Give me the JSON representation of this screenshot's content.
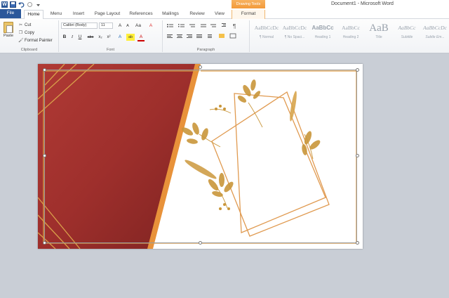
{
  "titlebar": {
    "document_title": "Document1 - Microsoft Word",
    "context_group": "Drawing Tools",
    "qat_icons": [
      "word-logo-icon",
      "save-icon",
      "undo-icon",
      "redo-icon",
      "customize-qat-icon"
    ]
  },
  "tabs": [
    {
      "label": "File"
    },
    {
      "label": "Home"
    },
    {
      "label": "Menu"
    },
    {
      "label": "Insert"
    },
    {
      "label": "Page Layout"
    },
    {
      "label": "References"
    },
    {
      "label": "Mailings"
    },
    {
      "label": "Review"
    },
    {
      "label": "View"
    },
    {
      "label": "Format"
    }
  ],
  "ribbon": {
    "clipboard": {
      "paste": "Paste",
      "cut": "Cut",
      "copy": "Copy",
      "format_painter": "Format Painter",
      "label": "Clipboard"
    },
    "font": {
      "font_name": "Calibri (Body)",
      "font_size": "11",
      "label": "Font",
      "buttons": [
        "B",
        "I",
        "U",
        "abc",
        "x₂",
        "x²",
        "A",
        "ab",
        "A"
      ]
    },
    "paragraph": {
      "label": "Paragraph"
    },
    "styles": {
      "items": [
        {
          "sample": "AaBbCcDc",
          "name": "¶ Normal"
        },
        {
          "sample": "AaBbCcDc",
          "name": "¶ No Spaci..."
        },
        {
          "sample": "AaBbCc",
          "name": "Heading 1"
        },
        {
          "sample": "AaBbCc",
          "name": "Heading 2"
        },
        {
          "sample": "AaB",
          "name": "Title"
        },
        {
          "sample": "AaBbCc",
          "name": "Subtitle"
        },
        {
          "sample": "AaBbCcDc",
          "name": "Subtle Em..."
        }
      ]
    }
  },
  "colors": {
    "file_tab": "#2b579a",
    "card_red": "#a5302f",
    "card_gold": "#e0983f",
    "context_tab": "#f39a3a"
  }
}
